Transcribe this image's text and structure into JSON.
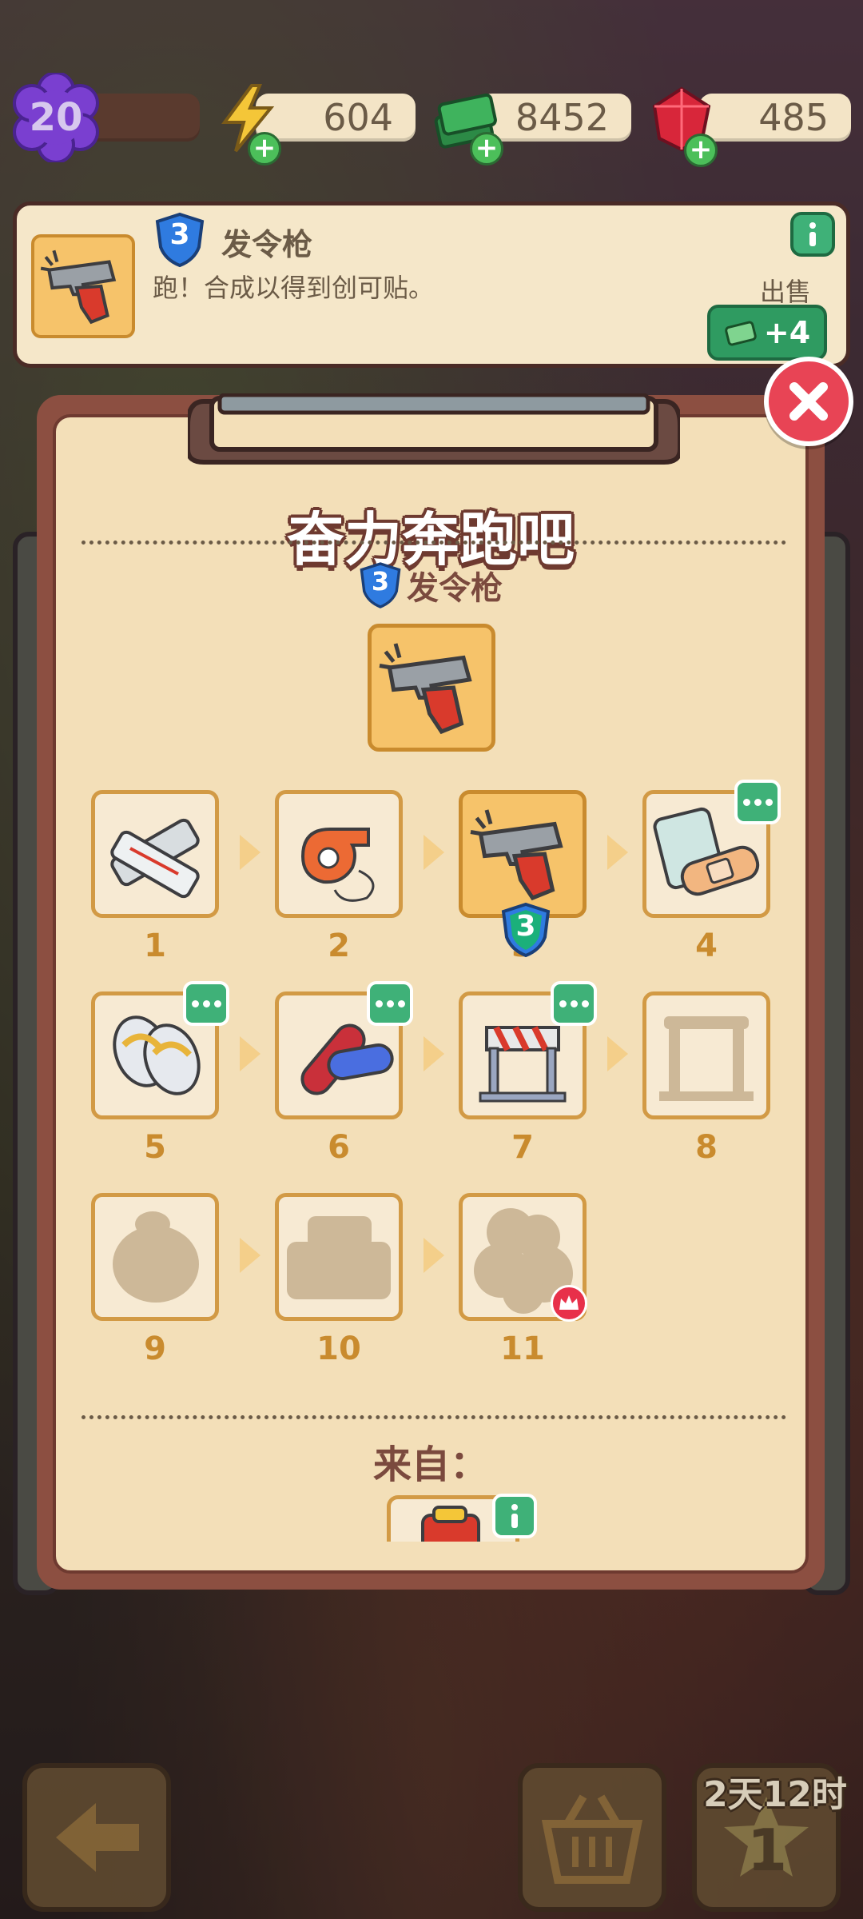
{
  "hud": {
    "level": "20",
    "energy": "604",
    "cash": "8452",
    "gems": "485"
  },
  "info_card": {
    "tier": "3",
    "name": "发令枪",
    "description": "跑！合成以得到创可贴。",
    "sell_label": "出售",
    "sell_value": "+4"
  },
  "modal": {
    "title": "奋力奔跑吧",
    "subtitle_tier": "3",
    "subtitle": "发令枪",
    "chain": [
      {
        "n": "1",
        "icon": "bandage-strip-icon",
        "unlocked": true
      },
      {
        "n": "2",
        "icon": "whistle-icon",
        "unlocked": true
      },
      {
        "n": "3",
        "icon": "starting-pistol-icon",
        "unlocked": true,
        "active": true,
        "badge": "3"
      },
      {
        "n": "4",
        "icon": "band-aid-pack-icon",
        "unlocked": true,
        "more": true
      },
      {
        "n": "5",
        "icon": "sneakers-icon",
        "unlocked": true,
        "more": true
      },
      {
        "n": "6",
        "icon": "muscle-roller-icon",
        "unlocked": true,
        "more": true
      },
      {
        "n": "7",
        "icon": "hurdle-icon",
        "unlocked": true,
        "more": true
      },
      {
        "n": "8",
        "icon": "locked-item-icon",
        "unlocked": false
      },
      {
        "n": "9",
        "icon": "locked-item-icon",
        "unlocked": false
      },
      {
        "n": "10",
        "icon": "locked-item-icon",
        "unlocked": false
      },
      {
        "n": "11",
        "icon": "locked-item-icon",
        "unlocked": false,
        "crown": true
      }
    ],
    "from_label": "来自："
  },
  "bottom": {
    "timer": "2天12时",
    "star_count": "1"
  }
}
